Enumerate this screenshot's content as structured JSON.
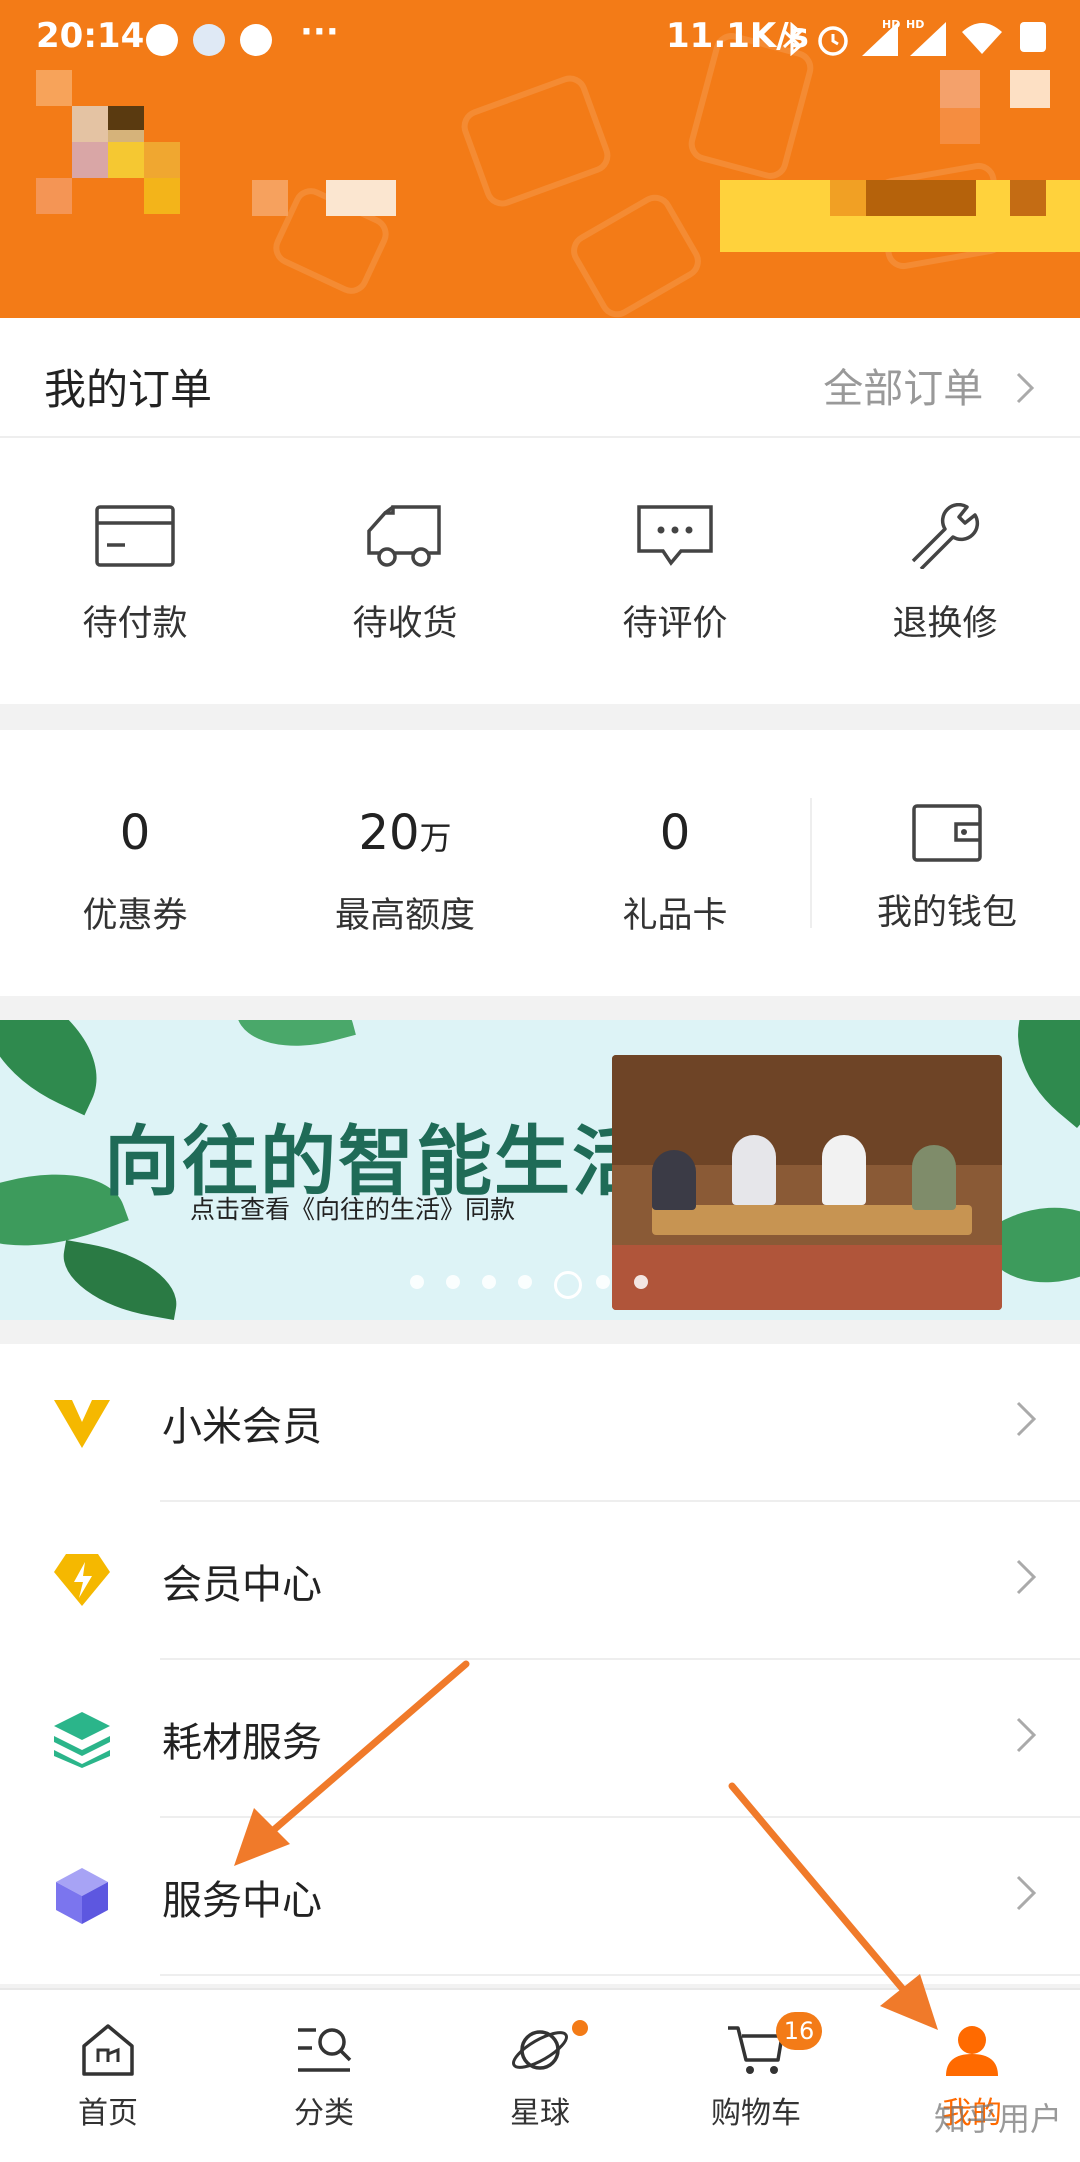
{
  "status_bar": {
    "time": "20:14",
    "network_speed": "11.1K/s",
    "more": "···"
  },
  "orders": {
    "title": "我的订单",
    "all_link": "全部订单",
    "items": [
      {
        "label": "待付款",
        "icon": "card-icon"
      },
      {
        "label": "待收货",
        "icon": "truck-icon"
      },
      {
        "label": "待评价",
        "icon": "comment-icon"
      },
      {
        "label": "退换修",
        "icon": "wrench-icon"
      }
    ]
  },
  "assets": {
    "items": [
      {
        "value": "0",
        "unit": "",
        "label": "优惠券"
      },
      {
        "value": "20",
        "unit": "万",
        "label": "最高额度"
      },
      {
        "value": "0",
        "unit": "",
        "label": "礼品卡"
      }
    ],
    "wallet_label": "我的钱包"
  },
  "banner": {
    "title": "向往的智能生活",
    "subtitle": "点击查看《向往的生活》同款"
  },
  "menu": [
    {
      "label": "小米会员",
      "icon": "v-member-icon"
    },
    {
      "label": "会员中心",
      "icon": "lightning-diamond-icon"
    },
    {
      "label": "耗材服务",
      "icon": "layers-icon"
    },
    {
      "label": "服务中心",
      "icon": "cube-icon"
    }
  ],
  "tabs": [
    {
      "label": "首页",
      "icon": "home-icon"
    },
    {
      "label": "分类",
      "icon": "category-search-icon"
    },
    {
      "label": "星球",
      "icon": "planet-icon"
    },
    {
      "label": "购物车",
      "icon": "cart-icon",
      "badge": "16"
    },
    {
      "label": "我的",
      "icon": "user-icon",
      "active": true
    }
  ],
  "watermark": "知乎用户",
  "colors": {
    "accent": "#f37b17",
    "active_tab": "#ff6a00",
    "annotation_arrow": "#f07a2a"
  }
}
